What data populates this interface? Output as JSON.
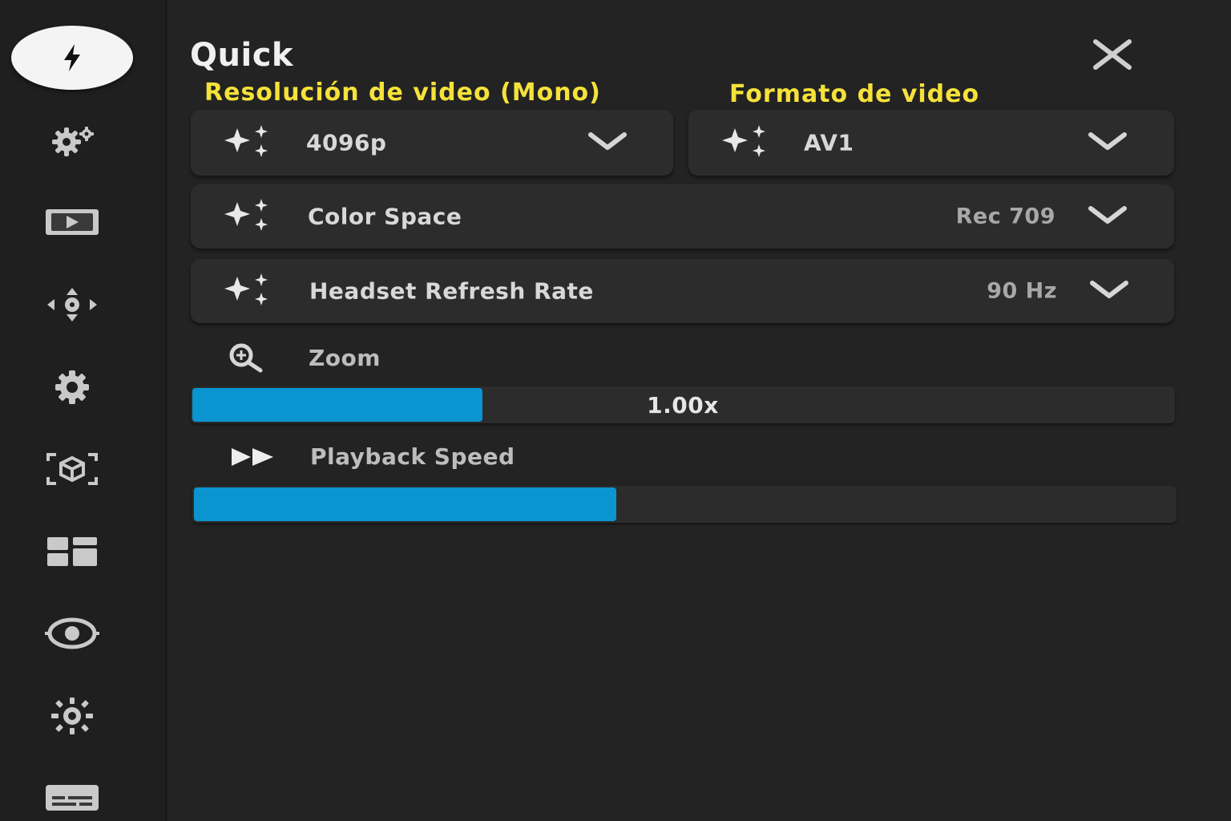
{
  "panel": {
    "title": "Quick"
  },
  "sidebar": {
    "items": [
      {
        "icon": "lightning-icon",
        "active": true
      },
      {
        "icon": "gears-icon",
        "active": false
      },
      {
        "icon": "video-play-icon",
        "active": false
      },
      {
        "icon": "move-arrows-icon",
        "active": false
      },
      {
        "icon": "settings-gear-icon",
        "active": false
      },
      {
        "icon": "3d-cube-scan-icon",
        "active": false
      },
      {
        "icon": "dashboard-grid-icon",
        "active": false
      },
      {
        "icon": "target-icon",
        "active": false
      },
      {
        "icon": "brightness-icon",
        "active": false
      },
      {
        "icon": "subtitles-icon",
        "active": false
      }
    ]
  },
  "annotations": {
    "resolution_label": "Resolución de video (Mono)",
    "format_label": "Formato de video"
  },
  "resolution": {
    "value": "4096p"
  },
  "format": {
    "value": "AV1"
  },
  "color_space": {
    "label": "Color Space",
    "value": "Rec 709"
  },
  "refresh_rate": {
    "label": "Headset Refresh Rate",
    "value": "90 Hz"
  },
  "zoom": {
    "label": "Zoom",
    "value": "1.00x",
    "fill_fraction": 0.295
  },
  "playback_speed": {
    "label": "Playback Speed",
    "value": "",
    "fill_fraction": 0.429
  },
  "colors": {
    "accent": "#0a95d0",
    "annotation": "#f5e23a",
    "background": "#232323"
  }
}
